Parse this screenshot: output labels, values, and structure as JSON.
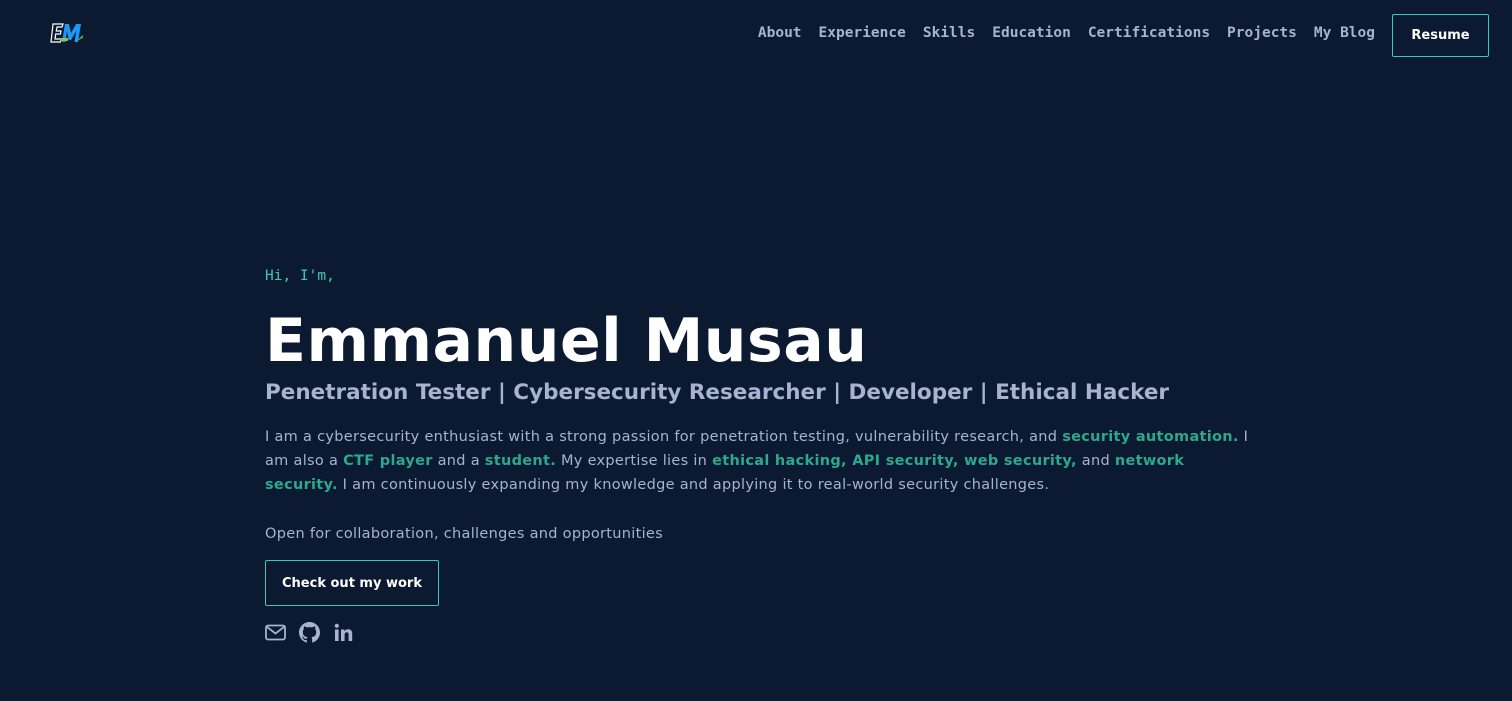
{
  "header": {
    "logo_icon": "em-monogram-logo",
    "nav": [
      {
        "label": "About"
      },
      {
        "label": "Experience"
      },
      {
        "label": "Skills"
      },
      {
        "label": "Education"
      },
      {
        "label": "Certifications"
      },
      {
        "label": "Projects"
      },
      {
        "label": "My Blog"
      }
    ],
    "resume_label": "Resume"
  },
  "hero": {
    "greeting": "Hi, I'm,",
    "name": "Emmanuel Musau",
    "subtitle": "Penetration Tester | Cybersecurity Researcher | Developer | Ethical Hacker",
    "bio": {
      "t1": "I am a cybersecurity enthusiast with a strong passion for penetration testing, vulnerability research, and ",
      "h1": "security automation.",
      "t2": " I am also a ",
      "h2": "CTF player",
      "t3": " and a ",
      "h3": "student.",
      "t4": " My expertise lies in ",
      "h4": "ethical hacking, API security, web security,",
      "t5": " and ",
      "h5": "network security.",
      "t6": " I am continuously expanding my knowledge and applying it to real-world security challenges."
    },
    "open_text": "Open for collaboration, challenges and opportunities",
    "cta_label": "Check out my work",
    "socials": [
      {
        "icon": "mail-icon"
      },
      {
        "icon": "github-icon"
      },
      {
        "icon": "linkedin-icon"
      }
    ]
  },
  "colors": {
    "background": "#0b1a30",
    "accent": "#41c7b9",
    "highlight": "#2ba88e",
    "text": "#a8b2d1",
    "heading": "#ffffff"
  }
}
